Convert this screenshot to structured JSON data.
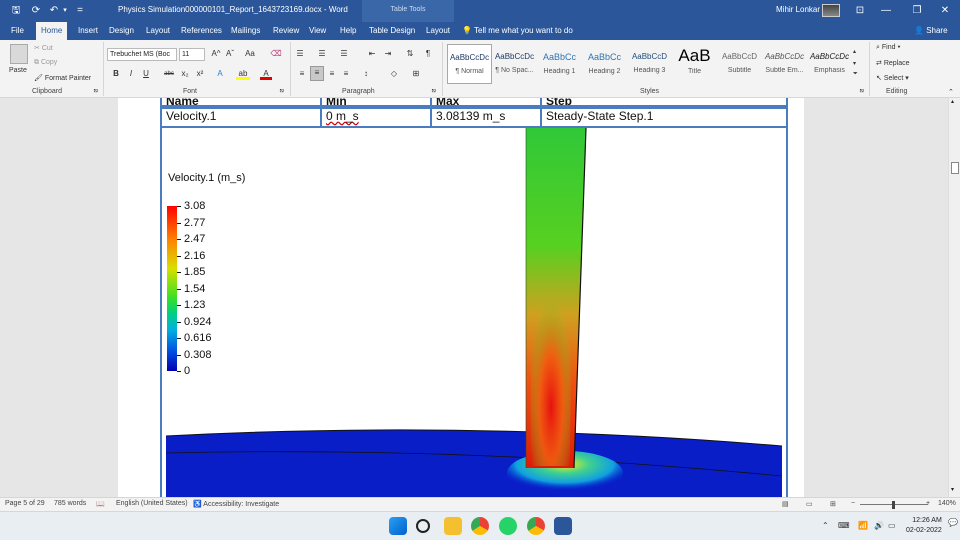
{
  "titlebar": {
    "doc_title": "Physics Simulation000000101_Report_1643723169.docx  -  Word",
    "table_tools": "Table Tools",
    "user_name": "Mihir Lonkar",
    "customize_glyph": "=",
    "minimize_glyph": "—",
    "restore_glyph": "❐",
    "close_glyph": "✕"
  },
  "tabs": [
    "File",
    "Home",
    "Insert",
    "Design",
    "Layout",
    "References",
    "Mailings",
    "Review",
    "View",
    "Help",
    "Table Design",
    "Layout"
  ],
  "tell_me": "Tell me what you want to do",
  "share": "Share",
  "ribbon": {
    "clipboard": {
      "paste": "Paste",
      "cut": "Cut",
      "copy": "Copy",
      "format_painter": "Format Painter",
      "label": "Clipboard"
    },
    "font": {
      "name": "Trebuchet MS (Boc",
      "size": "11",
      "label": "Font",
      "bold": "B",
      "italic": "I",
      "underline": "U",
      "strike": "abc",
      "subscript": "x₂",
      "superscript": "x²",
      "grow": "A^",
      "shrink": "Aˇ",
      "case": "Aa",
      "font_color": "A",
      "highlight": "ab"
    },
    "paragraph": {
      "label": "Paragraph"
    },
    "styles": {
      "label": "Styles",
      "items": [
        {
          "sample": "AaBbCcDc",
          "name": "¶ Normal"
        },
        {
          "sample": "AaBbCcDc",
          "name": "¶ No Spac..."
        },
        {
          "sample": "AaBbCc",
          "name": "Heading 1"
        },
        {
          "sample": "AaBbCc",
          "name": "Heading 2"
        },
        {
          "sample": "AaBbCcD",
          "name": "Heading 3"
        },
        {
          "sample": "AaB",
          "name": "Title"
        },
        {
          "sample": "AaBbCcD",
          "name": "Subtitle"
        },
        {
          "sample": "AaBbCcDc",
          "name": "Subtle Em..."
        },
        {
          "sample": "AaBbCcDc",
          "name": "Emphasis"
        }
      ]
    },
    "editing": {
      "find": "Find",
      "replace": "Replace",
      "select": "Select",
      "label": "Editing"
    }
  },
  "table": {
    "headers": [
      "Name",
      "Min",
      "Max",
      "Step"
    ],
    "row": [
      "Velocity.1",
      "0 m_s",
      "3.08139 m_s",
      "Steady-State Step.1"
    ]
  },
  "result": {
    "legend_title": "Velocity.1 (m_s)",
    "legend_values": [
      "3.08",
      "2.77",
      "2.47",
      "2.16",
      "1.85",
      "1.54",
      "1.23",
      "0.924",
      "0.616",
      "0.308",
      "0"
    ],
    "colors": {
      "max": "#ff0000",
      "mid": "#40e020",
      "min": "#0000b0"
    }
  },
  "statusbar": {
    "page": "Page 5 of 29",
    "words": "785 words",
    "language": "English (United States)",
    "accessibility": "Accessibility: Investigate",
    "zoom": "140%"
  },
  "taskbar": {
    "time": "12:26 AM",
    "date": "02-02-2022"
  }
}
